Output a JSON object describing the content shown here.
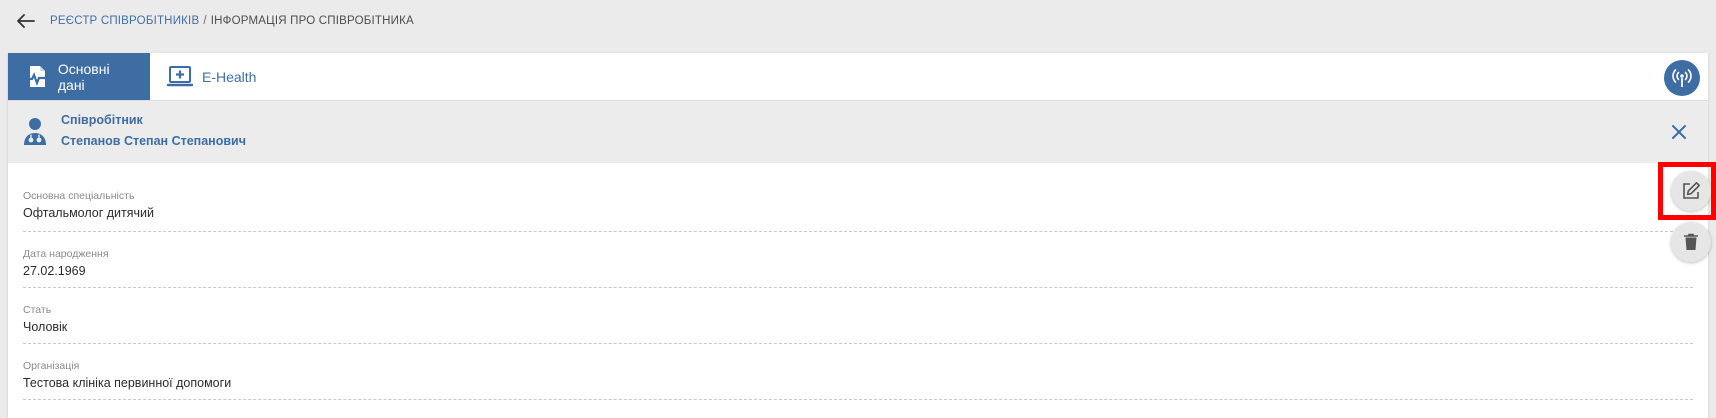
{
  "breadcrumb": {
    "parent": "Реєстр співробітників",
    "separator": "/",
    "current": "Інформація про співробітника"
  },
  "tabs": [
    {
      "label": "Основні дані",
      "icon": "document-pulse-icon",
      "active": true
    },
    {
      "label": "E-Health",
      "icon": "monitor-plus-icon",
      "active": false
    }
  ],
  "employee": {
    "role": "Співробітник",
    "name": "Степанов Степан Степанович"
  },
  "fields": [
    {
      "label": "Основна спеціальність",
      "value": "Офтальмолог дитячий"
    },
    {
      "label": "Дата народження",
      "value": "27.02.1969"
    },
    {
      "label": "Стать",
      "value": "Чоловік"
    },
    {
      "label": "Організація",
      "value": "Тестова клініка первинної допомоги"
    }
  ],
  "colors": {
    "accent": "#3d6da3",
    "highlight": "#ff0000"
  }
}
